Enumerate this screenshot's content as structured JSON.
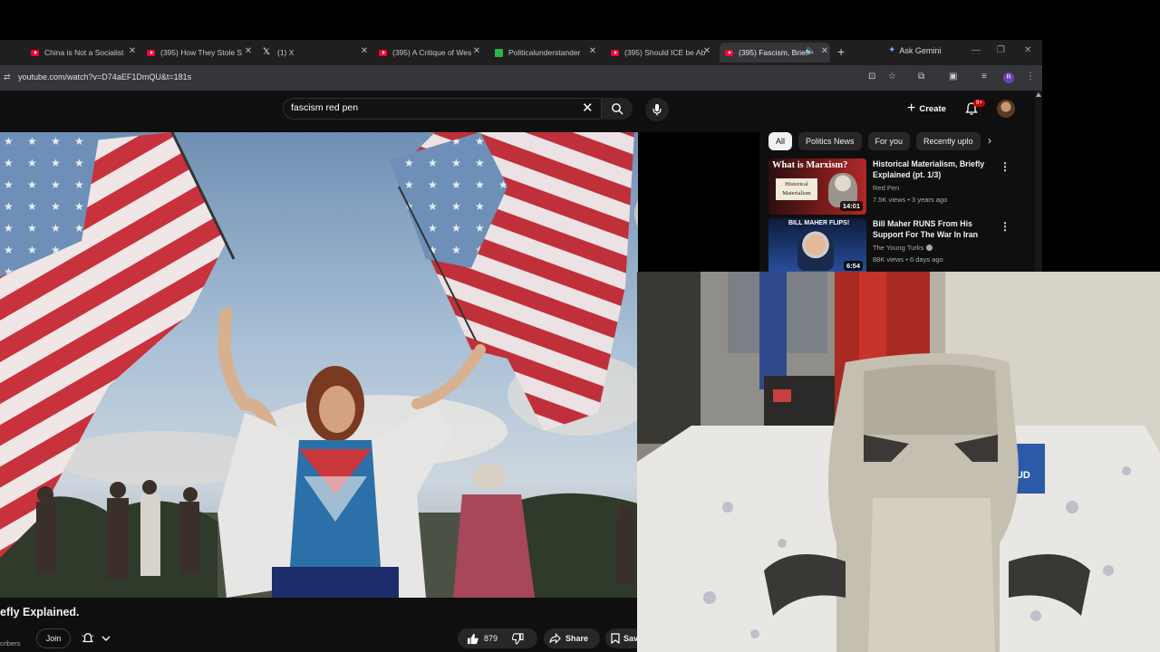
{
  "browser": {
    "tabs": [
      {
        "title": "China is Not a Socialist",
        "icon": "youtube-icon"
      },
      {
        "title": "(395) How They Stole S",
        "icon": "youtube-icon"
      },
      {
        "title": "(1) X",
        "icon": "x-icon"
      },
      {
        "title": "(395) A Critique of Wes",
        "icon": "youtube-icon"
      },
      {
        "title": "Politicalunderstander",
        "icon": "green-k-icon"
      },
      {
        "title": "(395) Should ICE be Ab",
        "icon": "youtube-icon"
      },
      {
        "title": "(395) Fascism, Brief",
        "icon": "youtube-icon",
        "active": true
      }
    ],
    "gemini_label": "Ask Gemini",
    "url": "youtube.com/watch?v=D74aEF1DmQU&t=181s",
    "profile_letter": "R"
  },
  "youtube": {
    "search_value": "fascism red pen",
    "create_label": "Create",
    "notification_badge": "9+",
    "video": {
      "title": "efly Explained.",
      "subscribers": "cribers",
      "join_label": "Join",
      "like_count": "879",
      "share_label": "Share",
      "save_label": "Sav"
    },
    "chips": [
      "All",
      "Politics News",
      "For you",
      "Recently uplo"
    ],
    "recommendations": [
      {
        "title": "Historical Materialism, Briefly Explained (pt. 1/3)",
        "channel": "Red Pen",
        "meta": "7.5K views • 3 years ago",
        "duration": "14:01",
        "thumb_text": "What is Marxism?",
        "thumb_sub": "Historical Materialism",
        "verified": false
      },
      {
        "title": "Bill Maher RUNS From His Support For The War In Iran",
        "channel": "The Young Turks",
        "meta": "88K views • 6 days ago",
        "duration": "6:54",
        "thumb_text": "BILL MAHER FLIPS!",
        "verified": true
      }
    ]
  },
  "colors": {
    "yt_bg": "#0f0f0f",
    "yt_red": "#ff0033",
    "chip_bg": "#272727",
    "chip_active": "#f1f1f1"
  }
}
